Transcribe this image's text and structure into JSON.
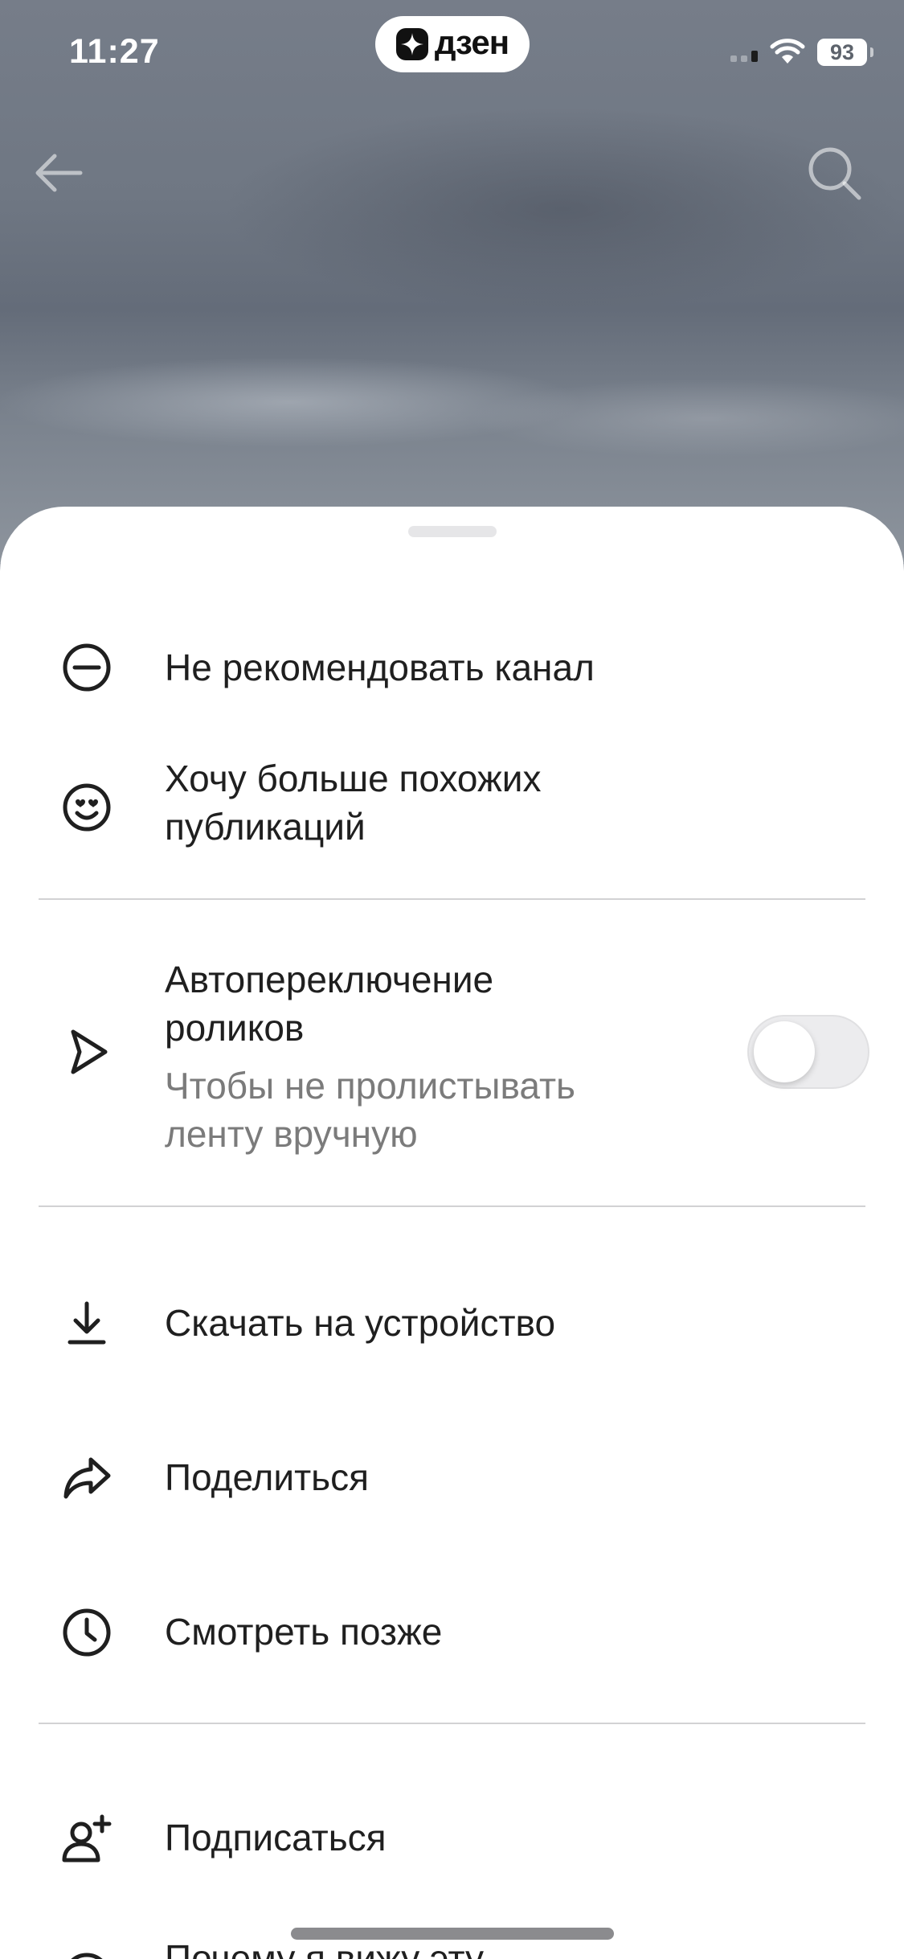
{
  "status_bar": {
    "time": "11:27",
    "battery": "93",
    "app_name": "дзен"
  },
  "header": {
    "back_icon": "arrow-left-icon",
    "search_icon": "search-icon"
  },
  "menu": {
    "items": [
      {
        "id": "not-recommend",
        "label": "Не рекомендовать канал",
        "icon": "minus-circle-icon"
      },
      {
        "id": "more-similar",
        "label_line1": "Хочу больше похожих",
        "label_line2": "публикаций",
        "icon": "smiling-face-icon"
      },
      {
        "id": "autoplay",
        "label_line1": "Автопереключение",
        "label_line2": "роликов",
        "sub_line1": "Чтобы не пролистывать",
        "sub_line2": "ленту вручную",
        "icon": "play-outline-icon",
        "toggle_on": false
      },
      {
        "id": "download",
        "label": "Скачать на устройство",
        "icon": "download-icon"
      },
      {
        "id": "share",
        "label": "Поделиться",
        "icon": "share-arrow-icon"
      },
      {
        "id": "watch-later",
        "label": "Смотреть позже",
        "icon": "clock-icon"
      },
      {
        "id": "subscribe",
        "label": "Подписаться",
        "icon": "user-plus-icon"
      },
      {
        "id": "why",
        "label": "Почему я вижу эту",
        "icon": "info-icon"
      }
    ]
  },
  "colors": {
    "sheet_bg": "#ffffff",
    "text_primary": "#1f1f1f",
    "text_secondary": "#7b7b7b",
    "divider": "#d2d2d4"
  }
}
